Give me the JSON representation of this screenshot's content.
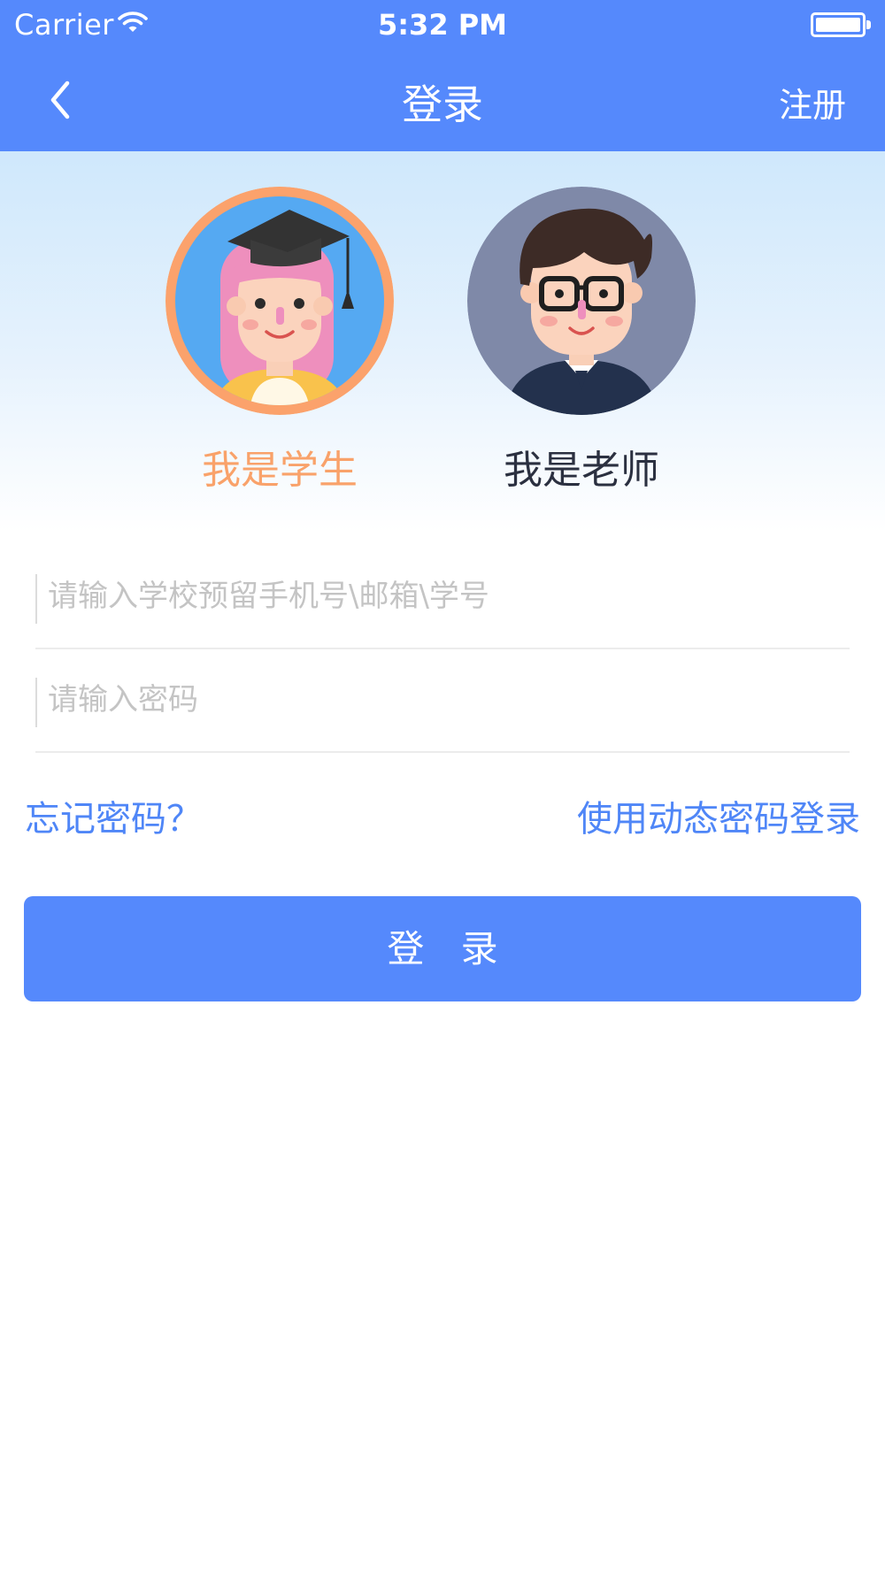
{
  "status_bar": {
    "carrier": "Carrier",
    "time": "5:32 PM"
  },
  "nav": {
    "title": "登录",
    "right_action": "注册",
    "back_icon": "chevron-left-icon"
  },
  "roles": {
    "student": {
      "label": "我是学生",
      "selected": true
    },
    "teacher": {
      "label": "我是老师",
      "selected": false
    }
  },
  "form": {
    "account_placeholder": "请输入学校预留手机号\\邮箱\\学号",
    "account_value": "",
    "password_placeholder": "请输入密码",
    "password_value": ""
  },
  "links": {
    "forgot_password": "忘记密码？",
    "dynamic_password_login": "使用动态密码登录"
  },
  "login_button": "登 录",
  "colors": {
    "primary": "#5589fc",
    "student_accent": "#f9a26a",
    "link": "#4f86f7"
  }
}
